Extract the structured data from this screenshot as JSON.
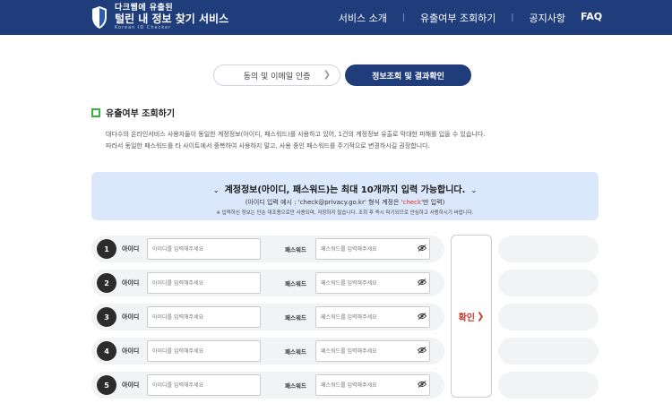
{
  "header": {
    "logo_sub": "다크웹에 유출된",
    "logo_title": "털린 내 정보 찾기 서비스",
    "logo_en": "Korean ID Checker",
    "nav": [
      "서비스 소개",
      "유출여부 조회하기",
      "공지사항",
      "FAQ"
    ],
    "brand_color": "#1f3d7a"
  },
  "steps": {
    "step1": "동의 및 이메일 인증",
    "step2": "정보조회 및 결과확인"
  },
  "section": {
    "title": "유출여부 조회하기",
    "desc1": "대다수의 온라인서비스 사용자들이 동일한 계정정보(아이디, 패스워드)를 사용하고 있어, 1건의 계정정보 유출로 막대한 피해를 입을 수 있습니다.",
    "desc2": "따라서 동일한 패스워드를 타 사이트에서 중복하여 사용하지 말고, 사용 중인 패스워드를 주기적으로 변경하시길 권장합니다."
  },
  "banner": {
    "main": "계정정보(아이디, 패스워드)는 최대 10개까지 입력 가능합니다.",
    "example_pre": "(아이디 입력 예시 : 'check@privacy.go.kr' 형식 계정은 '",
    "example_red": "check",
    "example_post": "'만 입력)",
    "note": "※ 입력하신 정보는 단순 대조용으로만 사용되며, 저장하지 않습니다. 조회 후 즉시 파기되므로 안심하고 사용하시기 바랍니다."
  },
  "form": {
    "id_label": "아이디",
    "pw_label": "패스워드",
    "id_placeholder": "아이디를 입력해주세요",
    "pw_placeholder": "패스워드를 입력해주세요",
    "rows": [
      "1",
      "2",
      "3",
      "4",
      "5"
    ],
    "confirm_label": "확인"
  }
}
